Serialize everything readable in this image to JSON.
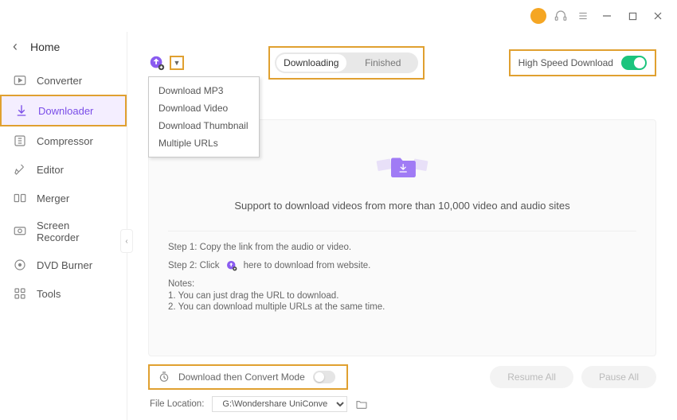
{
  "titlebar": {},
  "sidebar": {
    "home": "Home",
    "items": [
      {
        "label": "Converter"
      },
      {
        "label": "Downloader"
      },
      {
        "label": "Compressor"
      },
      {
        "label": "Editor"
      },
      {
        "label": "Merger"
      },
      {
        "label": "Screen Recorder"
      },
      {
        "label": "DVD Burner"
      },
      {
        "label": "Tools"
      }
    ]
  },
  "dropdown": {
    "items": [
      "Download MP3",
      "Download Video",
      "Download Thumbnail",
      "Multiple URLs"
    ]
  },
  "tabs": {
    "downloading": "Downloading",
    "finished": "Finished"
  },
  "hsd": {
    "label": "High Speed Download"
  },
  "body": {
    "title": "Support to download videos from more than 10,000 video and audio sites",
    "step1": "Step 1: Copy the link from the audio or video.",
    "step2a": "Step 2: Click",
    "step2b": "here to download from website.",
    "notes_label": "Notes:",
    "note1": "1. You can just drag the URL to download.",
    "note2": "2. You can download multiple URLs at the same time."
  },
  "footer": {
    "convert_label": "Download then Convert Mode",
    "resume": "Resume All",
    "pause": "Pause All",
    "file_loc_label": "File Location:",
    "file_loc_value": "G:\\Wondershare UniConverter"
  }
}
